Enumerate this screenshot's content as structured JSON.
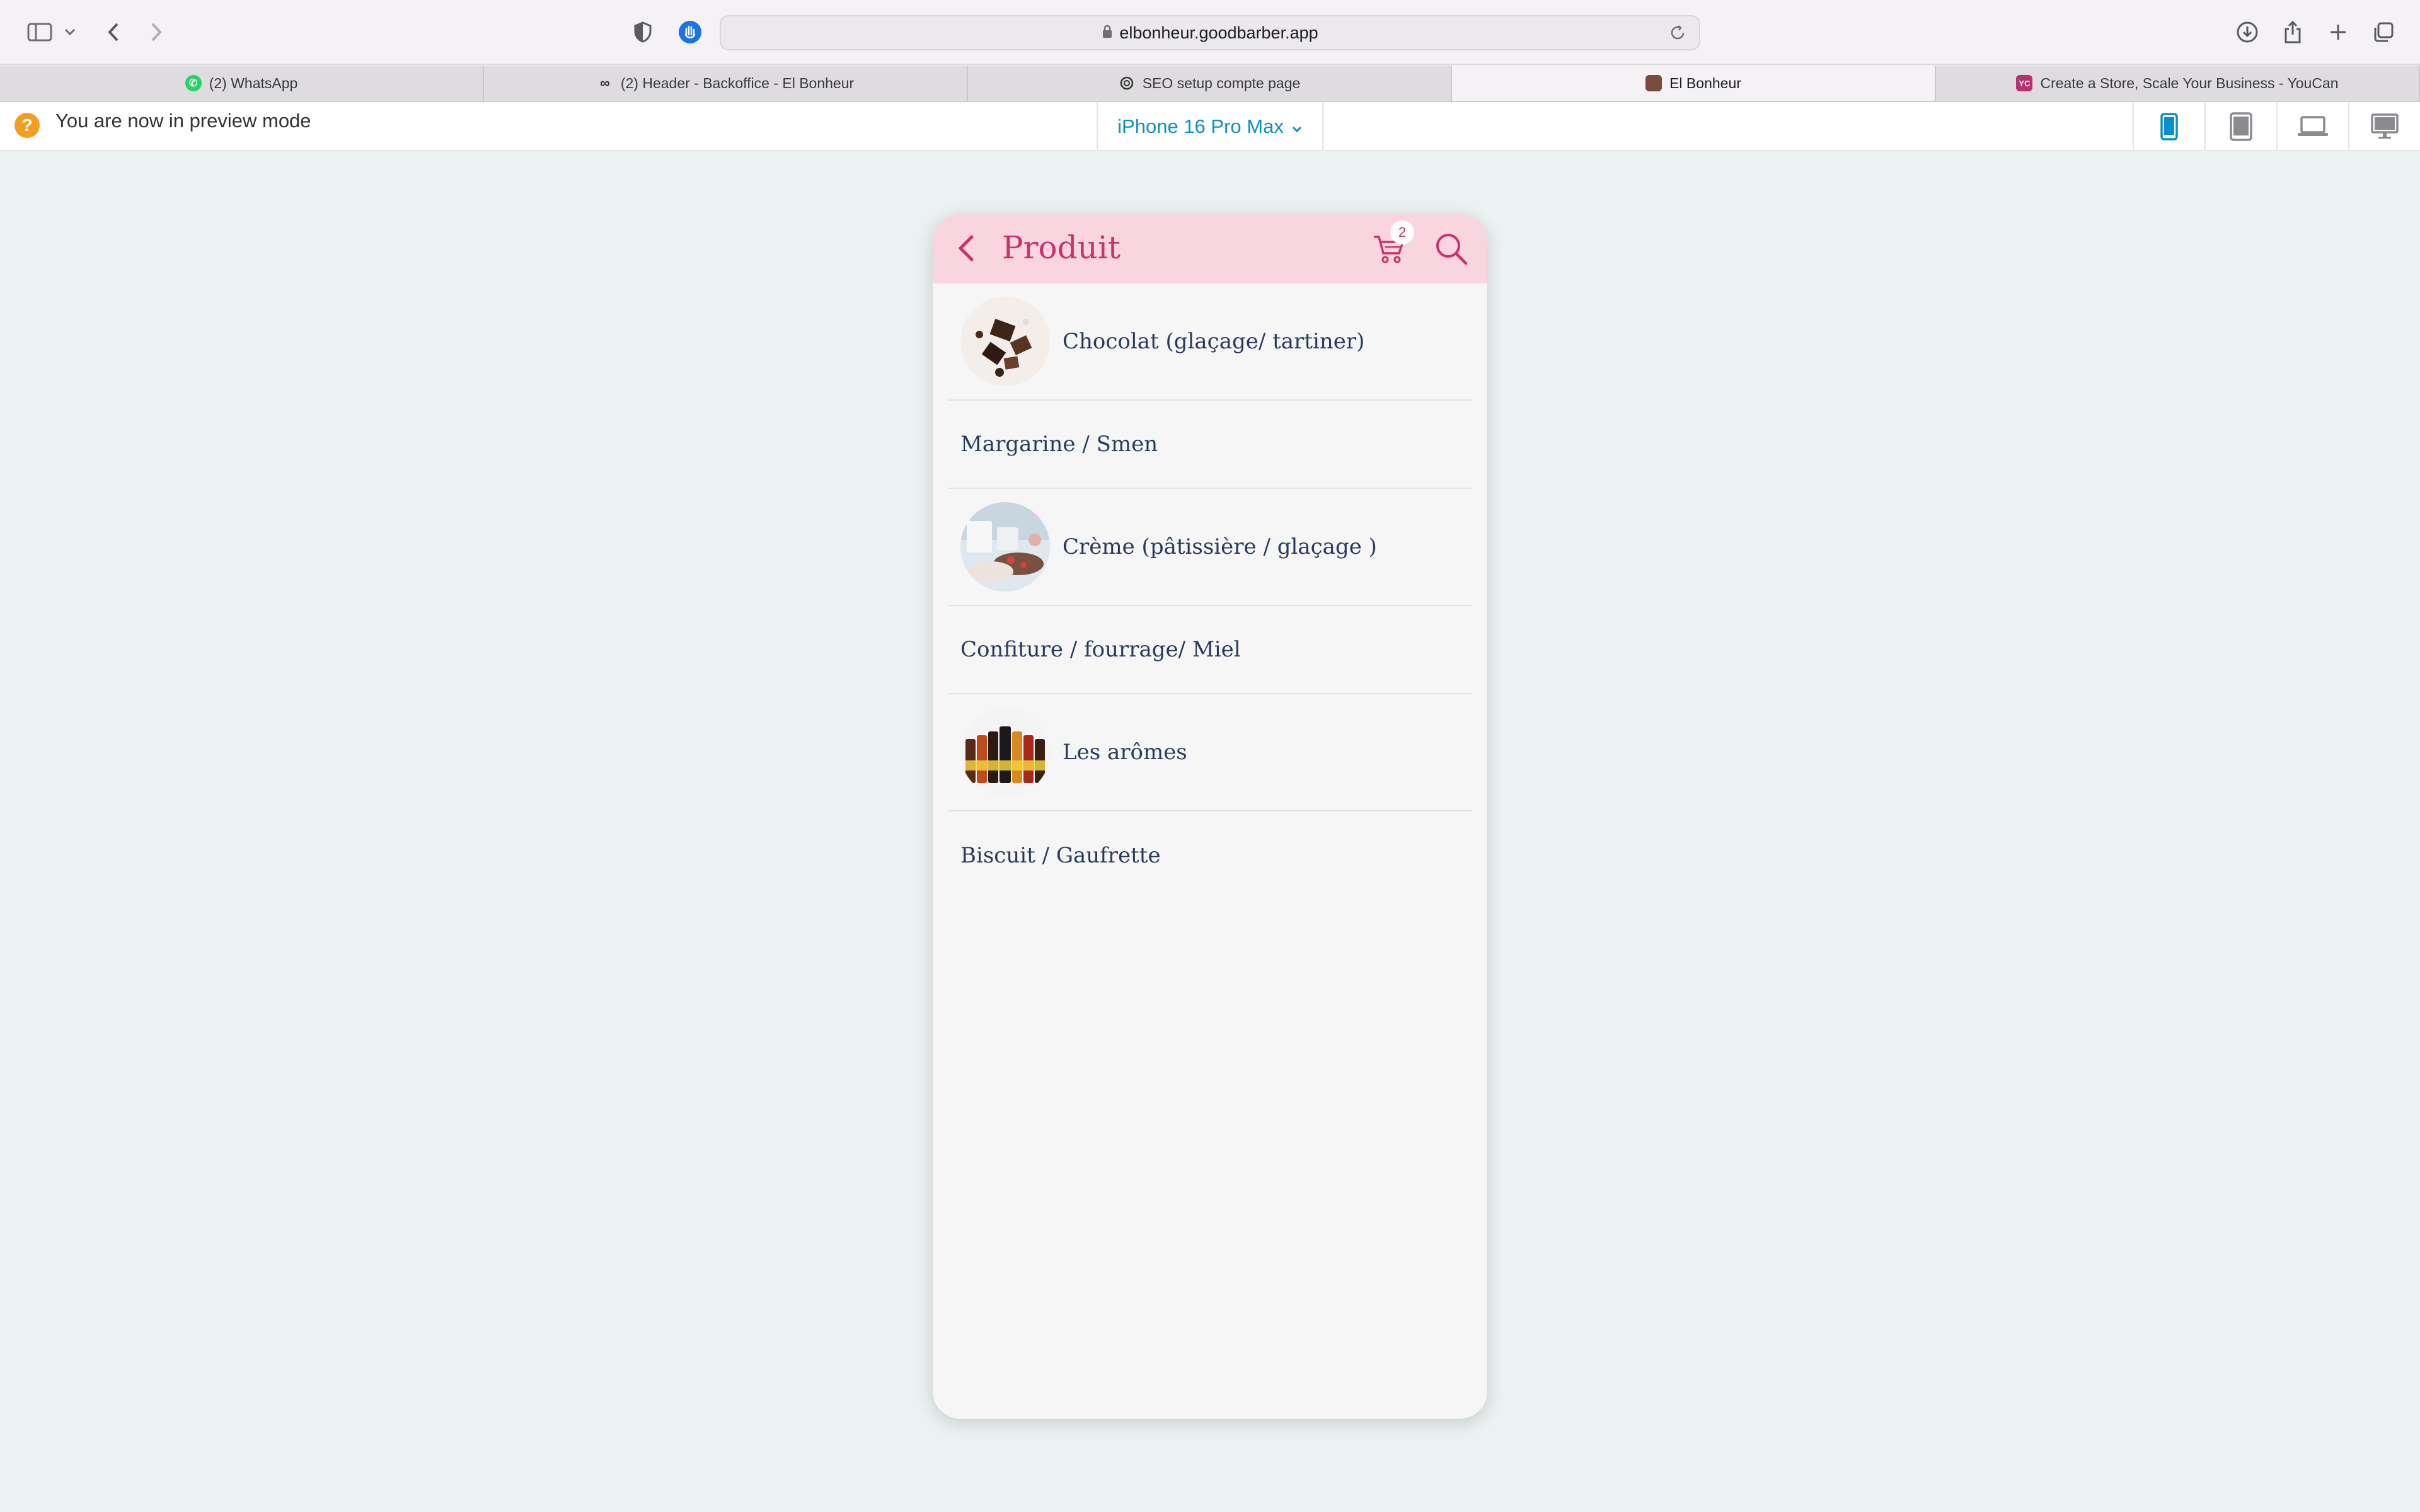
{
  "browser": {
    "url": "elbonheur.goodbarber.app",
    "tabs": [
      {
        "label": "(2) WhatsApp",
        "icon": "whatsapp-icon",
        "color": "#25d366"
      },
      {
        "label": "(2) Header - Backoffice - El Bonheur",
        "icon": "goodbarber-icon",
        "color": "#333333"
      },
      {
        "label": "SEO setup compte page",
        "icon": "chatgpt-icon",
        "color": "#333333"
      },
      {
        "label": "El Bonheur",
        "icon": "elbonheur-icon",
        "color": "#7a4a3a",
        "active": true
      },
      {
        "label": "Create a Store, Scale Your Business - YouCan",
        "icon": "youcan-icon",
        "color": "#b8326f"
      }
    ]
  },
  "preview": {
    "message": "You are now in preview mode",
    "device": "iPhone 16 Pro Max",
    "device_options": [
      "phone-icon",
      "tablet-icon",
      "laptop-icon",
      "desktop-icon"
    ],
    "active_device": "phone-icon",
    "accent": "#0b8ec9"
  },
  "app": {
    "title": "Produit",
    "cart_count": "2",
    "header_color": "#f8d5df",
    "accent": "#c8336e",
    "items": [
      {
        "label": "Chocolat (glaçage/ tartiner)",
        "has_image": true
      },
      {
        "label": "Margarine / Smen",
        "has_image": false
      },
      {
        "label": "Crème (pâtissière / glaçage )",
        "has_image": true
      },
      {
        "label": "Confiture / fourrage/ Miel",
        "has_image": false
      },
      {
        "label": "Les arômes",
        "has_image": true
      },
      {
        "label": "Biscuit / Gaufrette",
        "has_image": false
      }
    ]
  }
}
